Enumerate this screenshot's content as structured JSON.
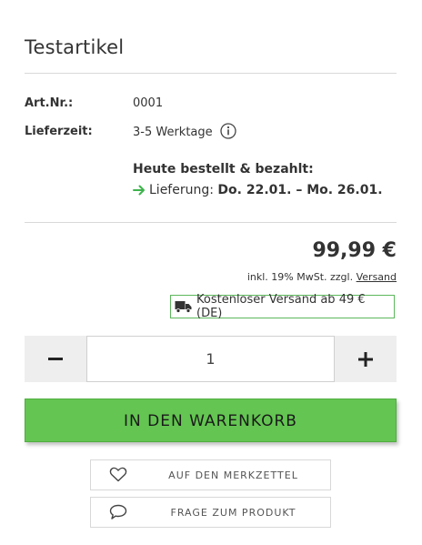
{
  "product": {
    "title": "Testartikel",
    "art_nr_label": "Art.Nr.:",
    "art_nr_value": "0001",
    "lieferzeit_label": "Lieferzeit:",
    "lieferzeit_value": "3-5 Werktage",
    "order_today": "Heute bestellt & bezahlt:",
    "delivery_prefix": "Lieferung:",
    "delivery_dates": "Do. 22.01. – Mo. 26.01.",
    "price": "99,99 €",
    "vat_text": "inkl. 19% MwSt. zzgl.",
    "vat_link": "Versand",
    "free_shipping": "Kostenloser Versand ab 49 € (DE)"
  },
  "quantity": {
    "value": "1",
    "minus": "–",
    "plus": "+"
  },
  "actions": {
    "cart": "IN DEN WARENKORB",
    "wishlist": "AUF DEN MERKZETTEL",
    "question": "FRAGE ZUM PRODUKT"
  },
  "colors": {
    "accent_green": "#64c552",
    "arrow_green": "#3cb44b",
    "border_gray": "#d8d8d8"
  },
  "icons": [
    "info-icon",
    "arrow-right-icon",
    "truck-icon",
    "minus-icon",
    "plus-icon",
    "heart-icon",
    "speech-bubble-icon"
  ]
}
